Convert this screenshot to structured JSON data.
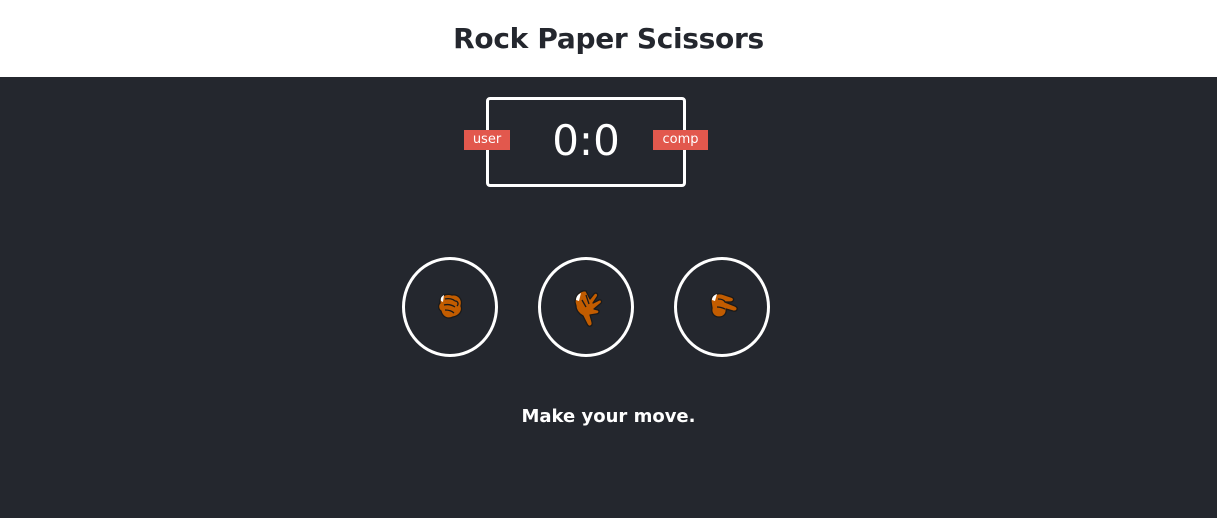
{
  "header": {
    "title": "Rock Paper Scissors"
  },
  "scoreboard": {
    "user_label": "user",
    "comp_label": "comp",
    "score": "0:0"
  },
  "choices": [
    {
      "id": "rock",
      "icon": "rock-hand-icon"
    },
    {
      "id": "paper",
      "icon": "paper-hand-icon"
    },
    {
      "id": "scissors",
      "icon": "scissors-hand-icon"
    }
  ],
  "message": "Make your move.",
  "colors": {
    "background": "#24272e",
    "header_background": "#ffffff",
    "badge": "#e2584d",
    "hand": "#c25c00"
  }
}
